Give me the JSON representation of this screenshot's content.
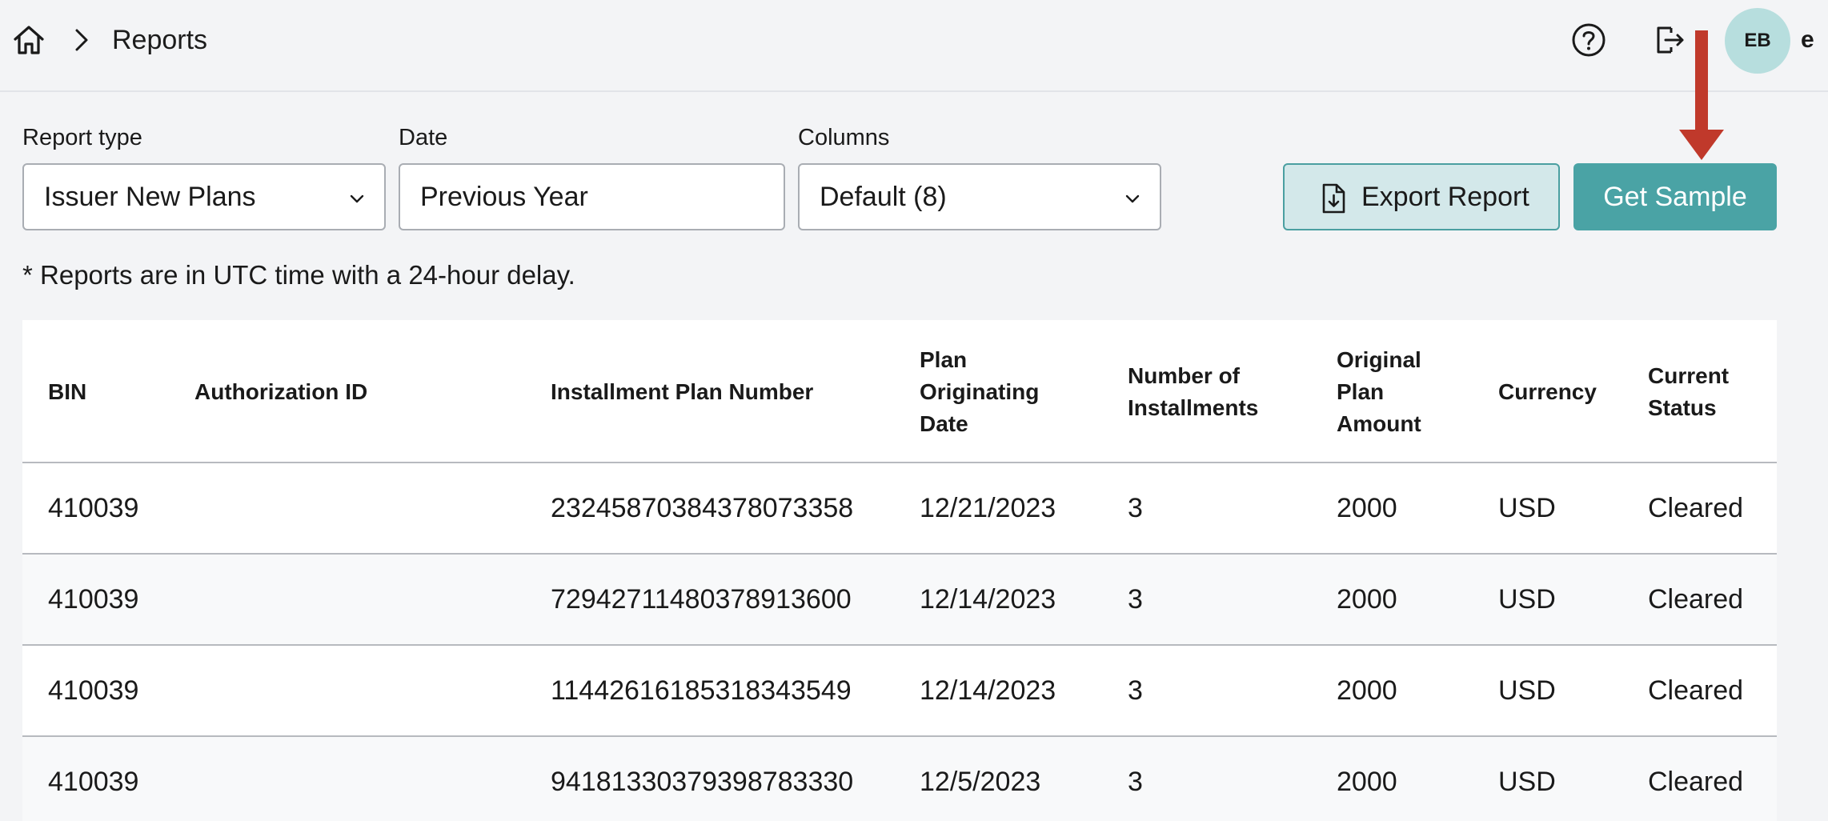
{
  "breadcrumb": {
    "home_icon": "home-icon",
    "separator_icon": "chevron-right-icon",
    "current": "Reports"
  },
  "header": {
    "help_icon": "help-circle-icon",
    "logout_icon": "logout-icon",
    "avatar_initials": "EB",
    "user_name": "e"
  },
  "filters": {
    "report_type": {
      "label": "Report type",
      "value": "Issuer New Plans"
    },
    "date": {
      "label": "Date",
      "value": "Previous Year"
    },
    "columns": {
      "label": "Columns",
      "value": "Default (8)"
    }
  },
  "actions": {
    "export_label": "Export Report",
    "sample_label": "Get Sample"
  },
  "note": "* Reports are in UTC time with a 24-hour delay.",
  "colors": {
    "accent": "#4aa3a5",
    "annotation_arrow": "#c0392b"
  },
  "table": {
    "headers": {
      "bin": "BIN",
      "auth_id": "Authorization ID",
      "plan_number": "Installment Plan Number",
      "orig_date_1": "Plan",
      "orig_date_2": "Originating",
      "orig_date_3": "Date",
      "num_inst_1": "Number of",
      "num_inst_2": "Installments",
      "amount_1": "Original",
      "amount_2": "Plan",
      "amount_3": "Amount",
      "currency": "Currency",
      "status_1": "Current",
      "status_2": "Status"
    },
    "rows": [
      {
        "bin": "410039",
        "auth_id": "",
        "plan_number": "23245870384378073358",
        "date": "12/21/2023",
        "installments": "3",
        "amount": "2000",
        "currency": "USD",
        "status": "Cleared"
      },
      {
        "bin": "410039",
        "auth_id": "",
        "plan_number": "72942711480378913600",
        "date": "12/14/2023",
        "installments": "3",
        "amount": "2000",
        "currency": "USD",
        "status": "Cleared"
      },
      {
        "bin": "410039",
        "auth_id": "",
        "plan_number": "11442616185318343549",
        "date": "12/14/2023",
        "installments": "3",
        "amount": "2000",
        "currency": "USD",
        "status": "Cleared"
      },
      {
        "bin": "410039",
        "auth_id": "",
        "plan_number": "94181330379398783330",
        "date": "12/5/2023",
        "installments": "3",
        "amount": "2000",
        "currency": "USD",
        "status": "Cleared"
      }
    ]
  }
}
